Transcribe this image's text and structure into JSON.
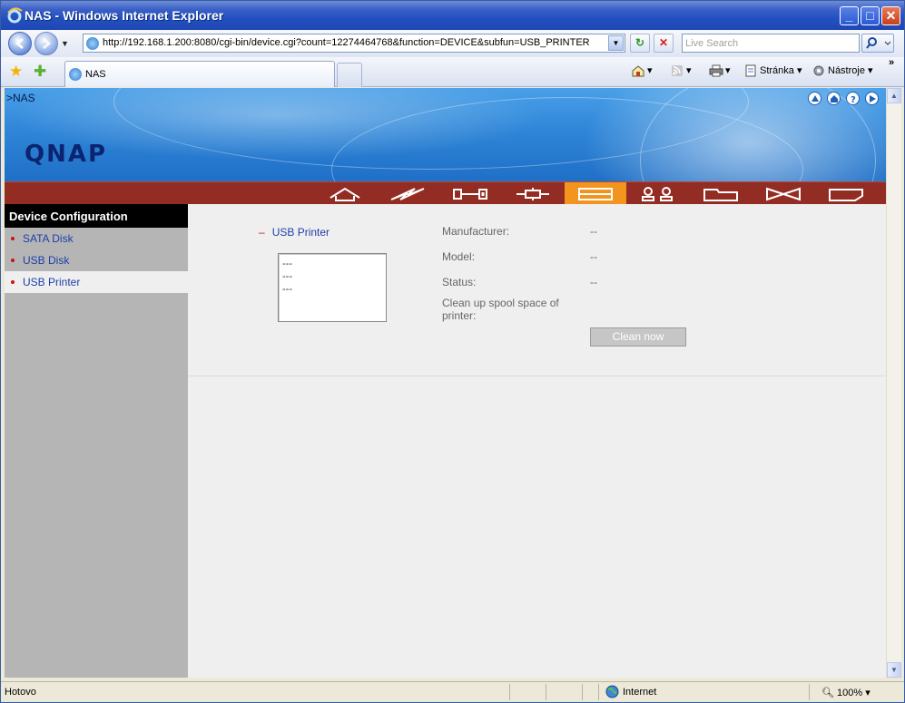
{
  "window": {
    "title": "NAS - Windows Internet Explorer",
    "minimize": "_",
    "maximize": "□",
    "close": "✕"
  },
  "navbar": {
    "url": "http://192.168.1.200:8080/cgi-bin/device.cgi?count=12274464768&function=DEVICE&subfun=USB_PRINTER",
    "search_placeholder": "Live Search"
  },
  "cmdbar": {
    "tab_label": "NAS",
    "page_menu": "Stránka",
    "tools_menu": "Nástroje",
    "overflow": "»"
  },
  "page": {
    "breadcrumb": ">NAS",
    "logo": "QNAP",
    "nav_icons": [
      "home-nav",
      "quick-config",
      "system-admin",
      "network",
      "device-config",
      "user-management",
      "network-share",
      "system-tools",
      "statistics"
    ],
    "active_nav": "device-config",
    "accent_color": "#f3941f",
    "bar_color": "#932d24"
  },
  "sidebar": {
    "heading": "Device Configuration",
    "items": [
      {
        "label": "SATA Disk"
      },
      {
        "label": "USB Disk"
      },
      {
        "label": "USB Printer"
      }
    ]
  },
  "content": {
    "section_title": "USB Printer",
    "section_marker": "–",
    "printer_list": [
      "---",
      "---",
      "---"
    ],
    "manufacturer_label": "Manufacturer:",
    "manufacturer_value": "--",
    "model_label": "Model:",
    "model_value": "--",
    "status_label": "Status:",
    "status_value": "--",
    "cleanup_label": "Clean up spool space of printer:",
    "cleanup_button": "Clean now"
  },
  "statusbar": {
    "status": "Hotovo",
    "zone": "Internet",
    "zoom": "100%"
  }
}
